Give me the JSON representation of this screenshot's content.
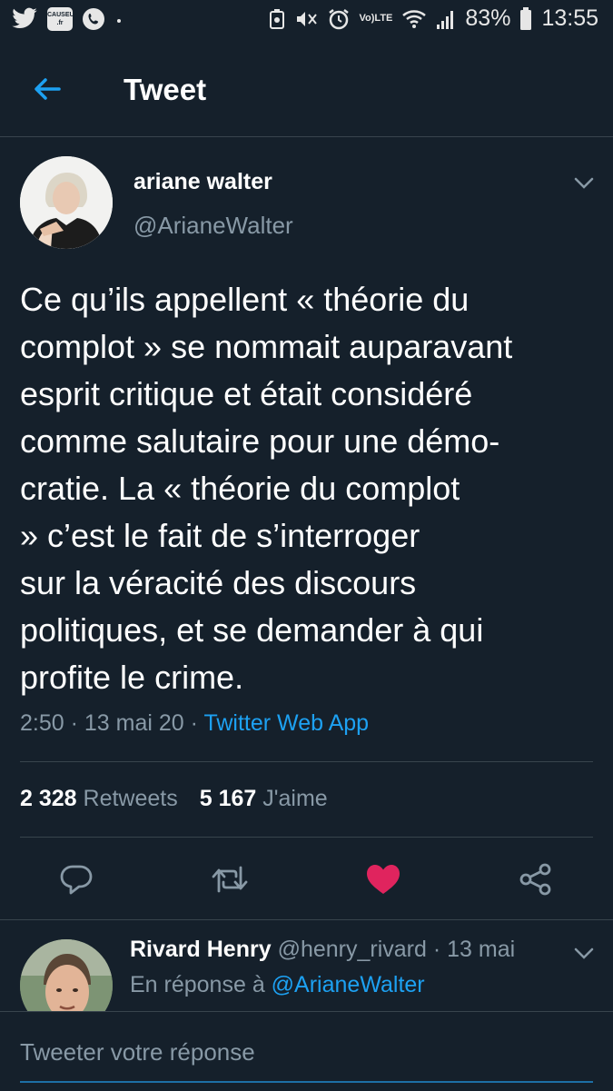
{
  "status_bar": {
    "causeur_badge": [
      "CAUSEUR",
      ".fr"
    ],
    "volte_label": [
      "Vo)",
      "LTE"
    ],
    "battery": "83%",
    "time": "13:55"
  },
  "header": {
    "title": "Tweet"
  },
  "tweet": {
    "author_name": "ariane walter",
    "author_handle": "@ArianeWalter",
    "text": "Ce qu’ils appellent « théorie du\ncomplot » se nommait auparavant\nesprit critique et était considéré\ncomme salutaire pour une démo-\ncratie. La « théorie du complot\n» c’est le fait de s’interroger\nsur la véracité des discours\npolitiques, et se demander à qui\nprofite le crime.",
    "time": "2:50",
    "date": "13 mai 20",
    "separator": "·",
    "source_app": "Twitter Web App",
    "retweets_count": "2 328",
    "retweets_label": "Retweets",
    "likes_count": "5 167",
    "likes_label": "J'aime"
  },
  "actions": {
    "reply_icon": "comment-icon",
    "retweet_icon": "retweet-icon",
    "like_icon": "heart-filled-icon",
    "share_icon": "share-icon"
  },
  "reply": {
    "author_name": "Rivard Henry",
    "author_handle": "@henry_rivard",
    "separator": "·",
    "date": "13 mai",
    "reply_prefix": "En réponse à",
    "reply_mention": "@ArianeWalter"
  },
  "composer": {
    "placeholder": "Tweeter votre réponse"
  },
  "colors": {
    "background": "#15202b",
    "accent": "#1da1f2",
    "secondary_text": "#8899a6",
    "divider": "#38444d",
    "like": "#e0245e"
  }
}
